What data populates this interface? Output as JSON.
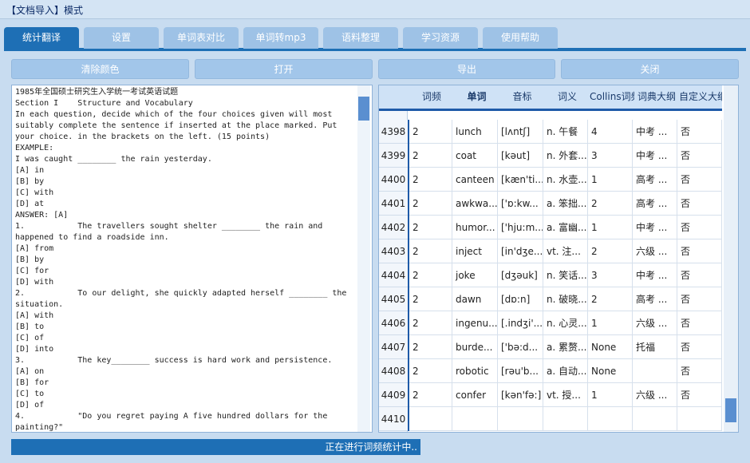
{
  "window": {
    "title": "【文档导入】模式"
  },
  "tabs": [
    {
      "label": "统计翻译",
      "active": true
    },
    {
      "label": "设置",
      "active": false
    },
    {
      "label": "单词表对比",
      "active": false
    },
    {
      "label": "单词转mp3",
      "active": false
    },
    {
      "label": "语料整理",
      "active": false
    },
    {
      "label": "学习资源",
      "active": false
    },
    {
      "label": "使用帮助",
      "active": false
    }
  ],
  "toolbar": {
    "clear_color": "清除颜色",
    "open": "打开",
    "export": "导出",
    "close": "关闭"
  },
  "document": {
    "text": "1985年全国硕士研究生入学统一考试英语试题\nSection I    Structure and Vocabulary\nIn each question, decide which of the four choices given will most suitably complete the sentence if inserted at the place marked. Put your choice. in the brackets on the left. (15 points)\nEXAMPLE:\nI was caught ________ the rain yesterday.\n[A] in\n[B] by\n[C] with\n[D] at\nANSWER: [A]\n1.           The travellers sought shelter ________ the rain and happened to find a roadside inn.\n[A] from\n[B] by\n[C] for\n[D] with\n2.           To our delight, she quickly adapted herself ________ the situation.\n[A] with\n[B] to\n[C] of\n[D] into\n3.           The key________ success is hard work and persistence.\n[A] on\n[B] for\n[C] to\n[D] of\n4.           \"Do you regret paying A five hundred dollars for the painting?\""
  },
  "grid": {
    "columns": [
      "词频",
      "单词",
      "音标",
      "词义",
      "Collins词频",
      "词典大纲",
      "自定义大纲"
    ],
    "rows": [
      {
        "num": "4398",
        "freq": "2",
        "word": "lunch",
        "phon": "[lʌntʃ]",
        "meaning": "n. 午餐",
        "collins": "4",
        "syllabus": "中考 ...",
        "custom": "否"
      },
      {
        "num": "4399",
        "freq": "2",
        "word": "coat",
        "phon": "[kəut]",
        "meaning": "n. 外套...",
        "collins": "3",
        "syllabus": "中考 ...",
        "custom": "否"
      },
      {
        "num": "4400",
        "freq": "2",
        "word": "canteen",
        "phon": "[kæn'ti...",
        "meaning": "n. 水壶...",
        "collins": "1",
        "syllabus": "高考 ...",
        "custom": "否"
      },
      {
        "num": "4401",
        "freq": "2",
        "word": "awkwa...",
        "phon": "['ɒ:kw...",
        "meaning": "a. 笨拙...",
        "collins": "2",
        "syllabus": "高考 ...",
        "custom": "否"
      },
      {
        "num": "4402",
        "freq": "2",
        "word": "humor...",
        "phon": "['hju:m...",
        "meaning": "a. 富幽...",
        "collins": "1",
        "syllabus": "中考 ...",
        "custom": "否"
      },
      {
        "num": "4403",
        "freq": "2",
        "word": "inject",
        "phon": "[in'dʒe...",
        "meaning": "vt. 注...",
        "collins": "2",
        "syllabus": "六级 ...",
        "custom": "否"
      },
      {
        "num": "4404",
        "freq": "2",
        "word": "joke",
        "phon": "[dʒəuk]",
        "meaning": "n. 笑话...",
        "collins": "3",
        "syllabus": "中考 ...",
        "custom": "否"
      },
      {
        "num": "4405",
        "freq": "2",
        "word": "dawn",
        "phon": "[dɒ:n]",
        "meaning": "n. 破晓...",
        "collins": "2",
        "syllabus": "高考 ...",
        "custom": "否"
      },
      {
        "num": "4406",
        "freq": "2",
        "word": "ingenu...",
        "phon": "[.indʒi'...",
        "meaning": "n. 心灵...",
        "collins": "1",
        "syllabus": "六级 ...",
        "custom": "否"
      },
      {
        "num": "4407",
        "freq": "2",
        "word": "burde...",
        "phon": "['bə:d...",
        "meaning": "a. 累赘...",
        "collins": "None",
        "syllabus": "托福",
        "custom": "否"
      },
      {
        "num": "4408",
        "freq": "2",
        "word": "robotic",
        "phon": "[rəu'b...",
        "meaning": "a. 自动...",
        "collins": "None",
        "syllabus": "",
        "custom": "否"
      },
      {
        "num": "4409",
        "freq": "2",
        "word": "confer",
        "phon": "[kən'fə:]",
        "meaning": "vt. 授...",
        "collins": "1",
        "syllabus": "六级 ...",
        "custom": "否"
      },
      {
        "num": "4410",
        "freq": "",
        "word": "",
        "phon": "",
        "meaning": "",
        "collins": "",
        "syllabus": "",
        "custom": ""
      }
    ]
  },
  "status": {
    "text": "正在进行词频统计中.."
  }
}
